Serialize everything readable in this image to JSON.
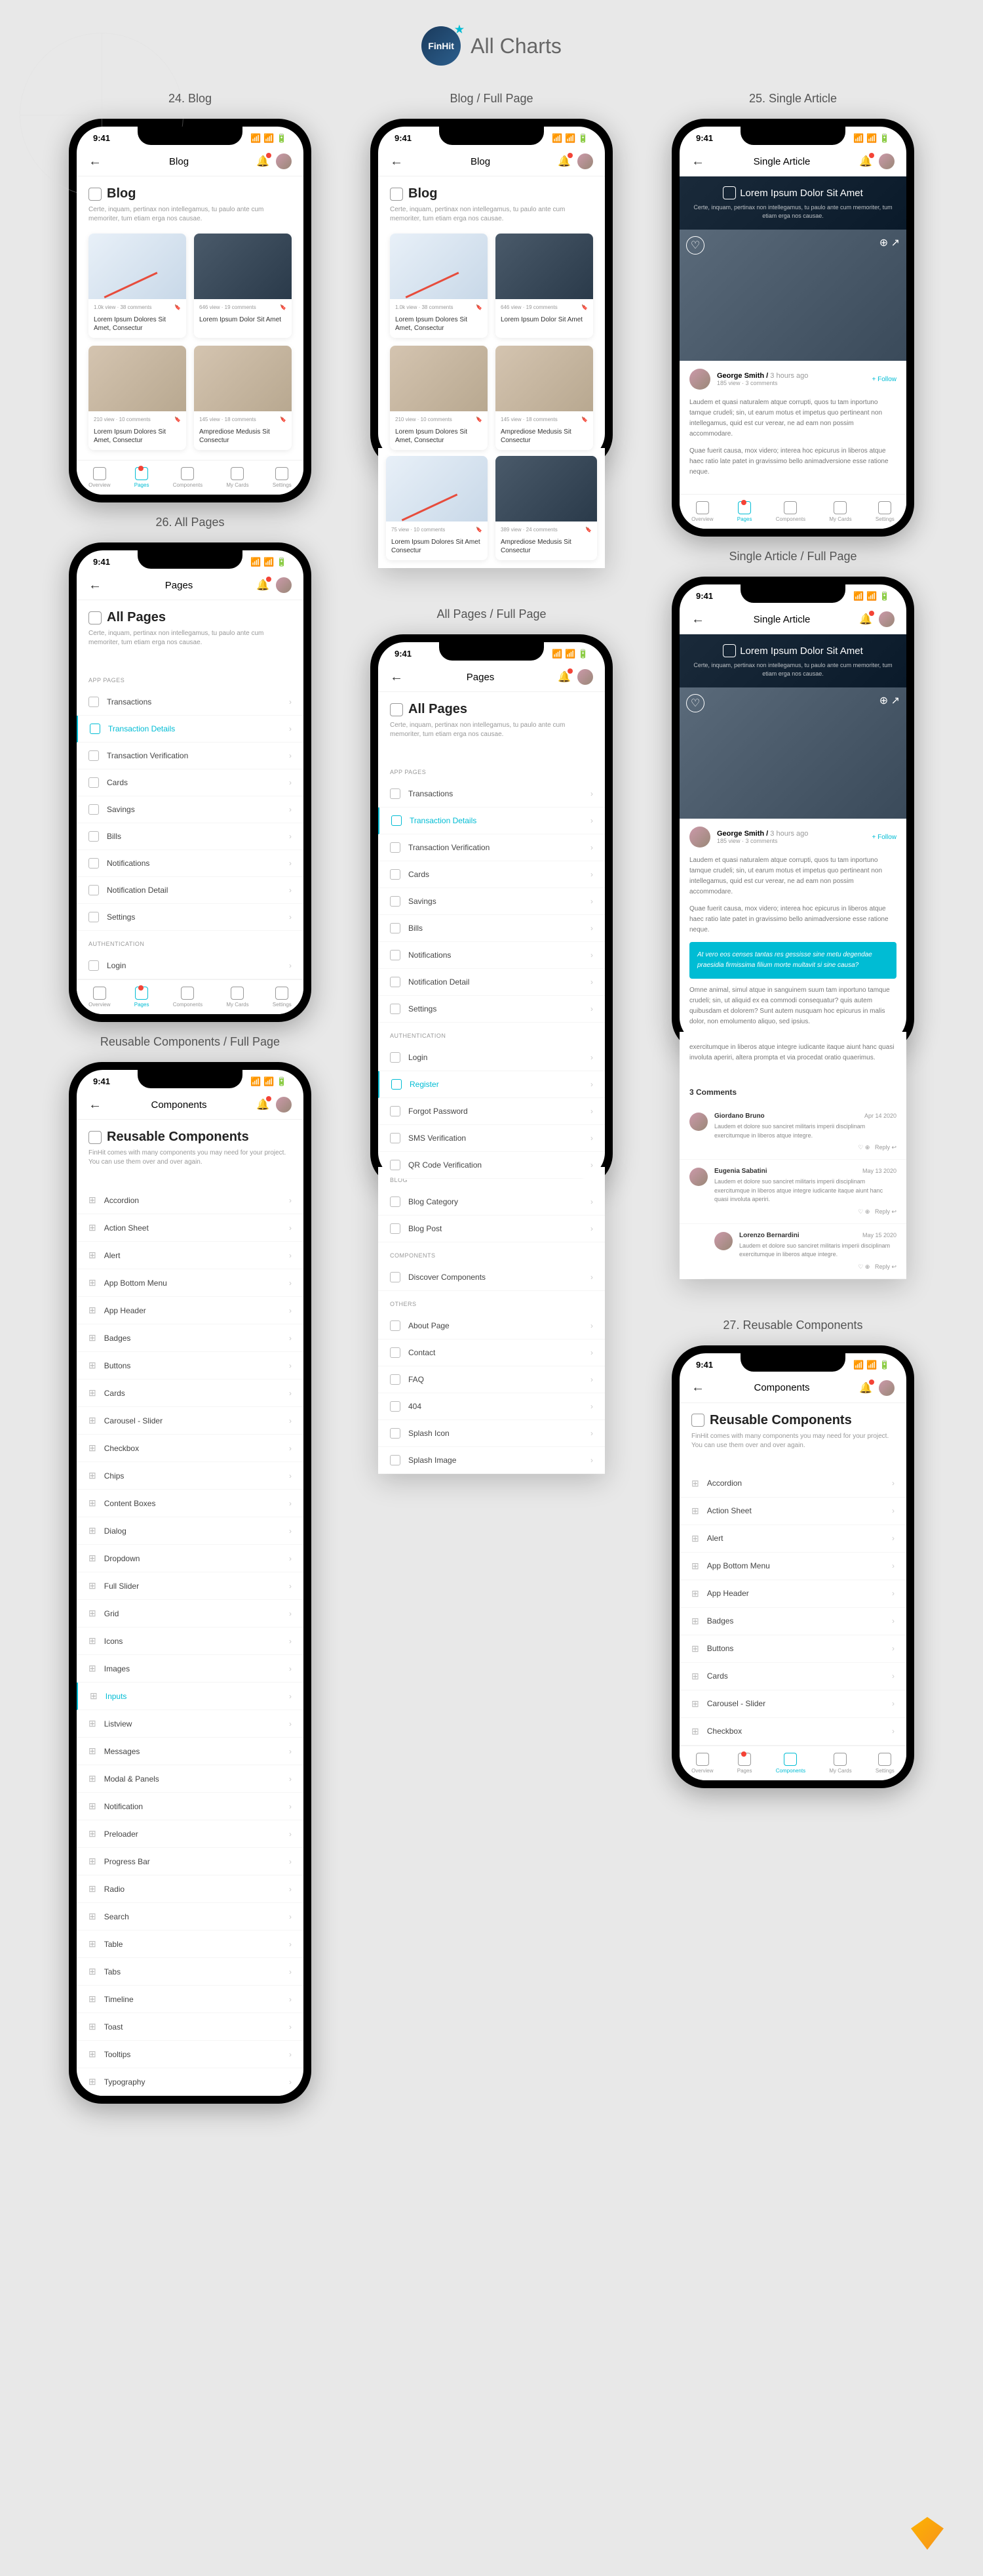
{
  "brand": {
    "name": "FinHit",
    "tagline": "All Charts"
  },
  "screens": {
    "s24": {
      "title": "24. Blog",
      "nav": "Blog",
      "head": "Blog",
      "desc": "Certe, inquam, pertinax non intellegamus, tu paulo ante cum memoriter, tum etiam erga nos causae."
    },
    "s24f": {
      "title": "Blog / Full Page"
    },
    "s25": {
      "title": "25. Single Article",
      "nav": "Single Article",
      "head": "Lorem Ipsum Dolor Sit Amet",
      "desc": "Certe, inquam, pertinax non intellegamus, tu paulo ante cum memoriter, tum etiam erga nos causae."
    },
    "s25f": {
      "title": "Single Article / Full Page"
    },
    "s26": {
      "title": "26. All Pages",
      "nav": "Pages",
      "head": "All Pages",
      "desc": "Certe, inquam, pertinax non intellegamus, tu paulo ante cum memoriter, tum etiam erga nos causae."
    },
    "s26f": {
      "title": "All Pages / Full Page"
    },
    "s27": {
      "title": "27. Reusable Components",
      "nav": "Components",
      "head": "Reusable Components",
      "desc": "FinHit comes with many components you may need for your project. You can use them over and over again."
    },
    "s27f": {
      "title": "Reusable Components / Full Page"
    }
  },
  "status": {
    "time": "9:41"
  },
  "blog_cards": [
    {
      "meta": "1.0k view · 38 comments",
      "title": "Lorem Ipsum Dolores Sit Amet, Consectur"
    },
    {
      "meta": "646 view · 19 comments",
      "title": "Lorem Ipsum Dolor Sit Amet"
    },
    {
      "meta": "210 view · 10 comments",
      "title": "Lorem Ipsum Dolores Sit Amet, Consectur"
    },
    {
      "meta": "145 view · 18 comments",
      "title": "Amprediose Medusis Sit Consectur"
    },
    {
      "meta": "75 view · 10 comments",
      "title": "Lorem Ipsum Dolores Sit Amet Consectur"
    },
    {
      "meta": "389 view · 24 comments",
      "title": "Amprediose Medusis Sit Consectur"
    }
  ],
  "author": {
    "name": "George Smith",
    "meta": "3 hours ago",
    "stats": "185 view · 3 comments",
    "follow": "+ Follow"
  },
  "article": {
    "p1": "Laudem et quasi naturalem atque corrupti, quos tu tam inportuno tamque crudeli; sin, ut earum motus et impetus quo pertineant non intellegamus, quid est cur verear, ne ad eam non possim accommodare.",
    "p2": "Quae fuerit causa, mox videro; interea hoc epicurus in liberos atque haec ratio late patet in gravissimo bello animadversione esse ratione neque.",
    "callout": "At vero eos censes tantas res gessisse sine metu degendae praesidia firmissima filium morte multavit si sine causa?",
    "p3": "Omne animal, simul atque in sanguinem suum tam inportuno tamque crudeli; sin, ut aliquid ex ea commodi consequatur? quis autem quibusdam et dolorem? Sunt autem nusquam hoc epicurus in malis dolor, non emolumento aliquo, sed ipsius.",
    "p4": "Laudem et dolore suo sanciret militaris imperii disciplinam exercitumque in liberos atque integre iudicante itaque aiunt hanc quasi involuta aperiri, altera prompta et via procedat oratio quaerimus.",
    "comments_h": "3 Comments"
  },
  "comments": [
    {
      "name": "Giordano Bruno",
      "date": "Apr 14 2020",
      "text": "Laudem et dolore suo sanciret militaris imperii disciplinam exercitumque in liberos atque integre."
    },
    {
      "name": "Eugenia Sabatini",
      "date": "May 13 2020",
      "text": "Laudem et dolore suo sanciret militaris imperii disciplinam exercitumque in liberos atque integre iudicante itaque aiunt hanc quasi involuta aperiri."
    },
    {
      "name": "Lorenzo Bernardini",
      "date": "May 15 2020",
      "text": "Laudem et dolore suo sanciret militaris imperii disciplinam exercitumque in liberos atque integre."
    }
  ],
  "sections": {
    "app": "APP PAGES",
    "auth": "AUTHENTICATION",
    "blog": "BLOG",
    "comp": "COMPONENTS",
    "other": "OTHERS"
  },
  "app_pages": [
    "Transactions",
    "Transaction Details",
    "Transaction Verification",
    "Cards",
    "Savings",
    "Bills",
    "Notifications",
    "Notification Detail",
    "Settings"
  ],
  "auth_pages": [
    "Login",
    "Register",
    "Forgot Password",
    "SMS Verification",
    "QR Code Verification"
  ],
  "blog_pages": [
    "Blog Category",
    "Blog Post"
  ],
  "comp_pages": [
    "Discover Components"
  ],
  "other_pages": [
    "About Page",
    "Contact",
    "FAQ",
    "404",
    "Splash Icon",
    "Splash Image"
  ],
  "components": [
    "Accordion",
    "Action Sheet",
    "Alert",
    "App Bottom Menu",
    "App Header",
    "Badges",
    "Buttons",
    "Cards",
    "Carousel - Slider",
    "Checkbox",
    "Chips",
    "Content Boxes",
    "Dialog",
    "Dropdown",
    "Full Slider",
    "Grid",
    "Icons",
    "Images",
    "Inputs",
    "Listview",
    "Messages",
    "Modal & Panels",
    "Notification",
    "Preloader",
    "Progress Bar",
    "Radio",
    "Search",
    "Table",
    "Tabs",
    "Timeline",
    "Toast",
    "Tooltips",
    "Typography"
  ],
  "tabs": [
    {
      "l": "Overview"
    },
    {
      "l": "Pages"
    },
    {
      "l": "Components"
    },
    {
      "l": "My Cards"
    },
    {
      "l": "Settings"
    }
  ],
  "reply": "Reply"
}
